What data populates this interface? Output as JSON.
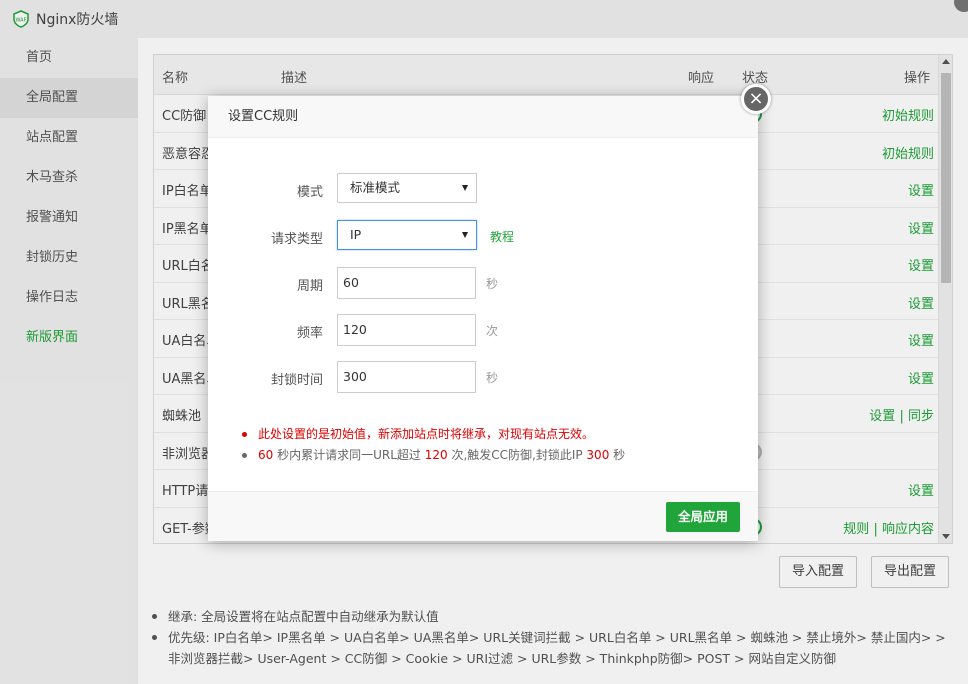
{
  "window": {
    "title": "Nginx防火墙"
  },
  "sidebar": {
    "items": [
      {
        "label": "首页"
      },
      {
        "label": "全局配置"
      },
      {
        "label": "站点配置"
      },
      {
        "label": "木马查杀"
      },
      {
        "label": "报警通知"
      },
      {
        "label": "封锁历史"
      },
      {
        "label": "操作日志"
      },
      {
        "label": "新版界面"
      }
    ],
    "active_index": 1
  },
  "table": {
    "headers": {
      "name": "名称",
      "desc": "描述",
      "resp": "响应",
      "status": "状态",
      "op": "操作"
    },
    "rows": [
      {
        "name": "CC防御",
        "op": "初始规则"
      },
      {
        "name": "恶意容忍",
        "op": "初始规则"
      },
      {
        "name": "IP白名单",
        "op": "设置"
      },
      {
        "name": "IP黑名单",
        "op": "设置"
      },
      {
        "name": "URL白名单",
        "op": "设置"
      },
      {
        "name": "URL黑名单",
        "op": "设置"
      },
      {
        "name": "UA白名单",
        "op": "设置"
      },
      {
        "name": "UA黑名单",
        "op": "设置"
      },
      {
        "name": "蜘蛛池",
        "op": "设置",
        "op2": "同步"
      },
      {
        "name": "非浏览器",
        "op": ""
      },
      {
        "name": "HTTP请求",
        "op": "设置"
      },
      {
        "name": "GET-参数",
        "op": "规则",
        "op2": "响应内容"
      }
    ]
  },
  "buttons": {
    "import": "导入配置",
    "export": "导出配置"
  },
  "notes": [
    "继承: 全局设置将在站点配置中自动继承为默认值",
    "优先级: IP白名单> IP黑名单 > UA白名单> UA黑名单> URL关键词拦截 > URL白名单 > URL黑名单 > 蜘蛛池 > 禁止境外> 禁止国内> > 非浏览器拦截> User-Agent > CC防御 > Cookie > URI过滤 > URL参数 > Thinkphp防御> POST > 网站自定义防御"
  ],
  "modal": {
    "title": "设置CC规则",
    "close_glyph": "×",
    "mode": {
      "label": "模式",
      "value": "标准模式"
    },
    "request_type": {
      "label": "请求类型",
      "value": "IP",
      "tutorial": "教程"
    },
    "period": {
      "label": "周期",
      "value": "60",
      "unit": "秒"
    },
    "frequency": {
      "label": "频率",
      "value": "120",
      "unit": "次"
    },
    "block_time": {
      "label": "封锁时间",
      "value": "300",
      "unit": "秒"
    },
    "tip_warning": "此处设置的是初始值，新添加站点时将继承，对现有站点无效。",
    "tip_summary": {
      "period": "60",
      "t1": " 秒内累计请求同一URL超过 ",
      "freq": "120",
      "t2": " 次,触发CC防御,封锁此IP ",
      "block": "300",
      "t3": " 秒"
    },
    "apply_button": "全局应用"
  },
  "colors": {
    "accent": "#20a53a",
    "warning": "#dd0000"
  },
  "icons": {
    "app": "nginx-waf-shield-icon",
    "close": "close-icon"
  }
}
